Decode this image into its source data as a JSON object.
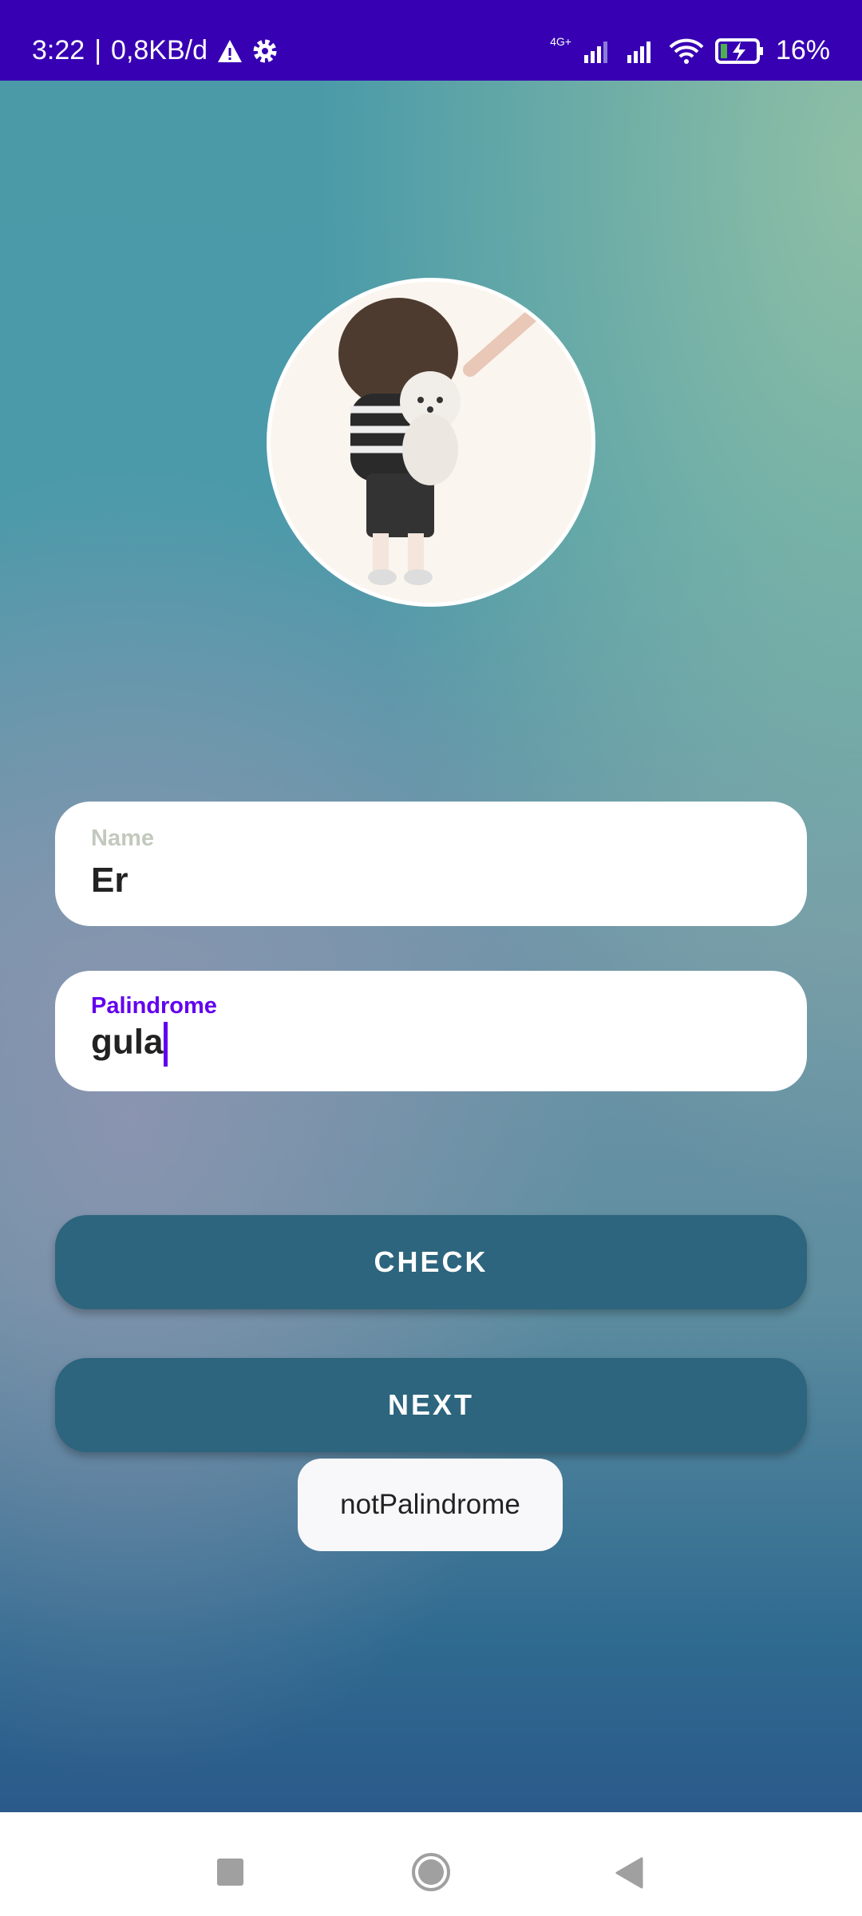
{
  "status_bar": {
    "time": "3:22",
    "data_rate": "0,8KB/d",
    "network": "4G+",
    "battery": "16%",
    "battery_level": 16,
    "icons": [
      "warning-icon",
      "gear-icon",
      "signal-icon",
      "wifi-icon",
      "battery-charging-icon"
    ]
  },
  "form": {
    "name": {
      "label": "Name",
      "value": "Er"
    },
    "palindrome": {
      "label": "Palindrome",
      "value": "gula"
    }
  },
  "buttons": {
    "check": "CHECK",
    "next": "NEXT"
  },
  "toast": "notPalindrome",
  "colors": {
    "status_bar": "#3700b3",
    "button": "#2c657d",
    "focused_label": "#6200ee",
    "label": "#c2c9bd"
  }
}
